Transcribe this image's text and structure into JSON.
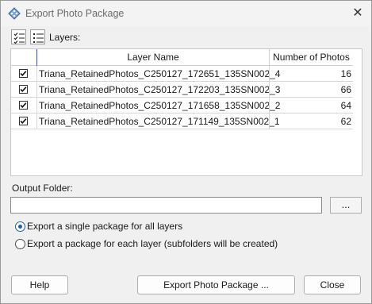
{
  "window": {
    "title": "Export Photo Package",
    "close_glyph": "✕"
  },
  "toolbar": {
    "label": "Layers:"
  },
  "table": {
    "columns": [
      "Layer Name",
      "Number of Photos"
    ],
    "rows": [
      {
        "checked": true,
        "name": "Triana_RetainedPhotos_C250127_172651_135SN002_4",
        "count": "16"
      },
      {
        "checked": true,
        "name": "Triana_RetainedPhotos_C250127_172203_135SN002_3",
        "count": "66"
      },
      {
        "checked": true,
        "name": "Triana_RetainedPhotos_C250127_171658_135SN002_2",
        "count": "64"
      },
      {
        "checked": true,
        "name": "Triana_RetainedPhotos_C250127_171149_135SN002_1",
        "count": "62"
      }
    ]
  },
  "output": {
    "label": "Output Folder:",
    "value": "",
    "browse_label": "..."
  },
  "options": [
    {
      "label": "Export a single package for all layers",
      "checked": true
    },
    {
      "label": "Export a package for each layer (subfolders will be created)",
      "checked": false
    }
  ],
  "buttons": {
    "help": "Help",
    "export": "Export Photo Package ...",
    "close": "Close"
  },
  "icons": {
    "app": "app-diamond-icon",
    "check_all": "check-all-icon",
    "list": "list-icon"
  },
  "colors": {
    "accent": "#1a5fb4",
    "column_divider": "#3a4fc4"
  }
}
